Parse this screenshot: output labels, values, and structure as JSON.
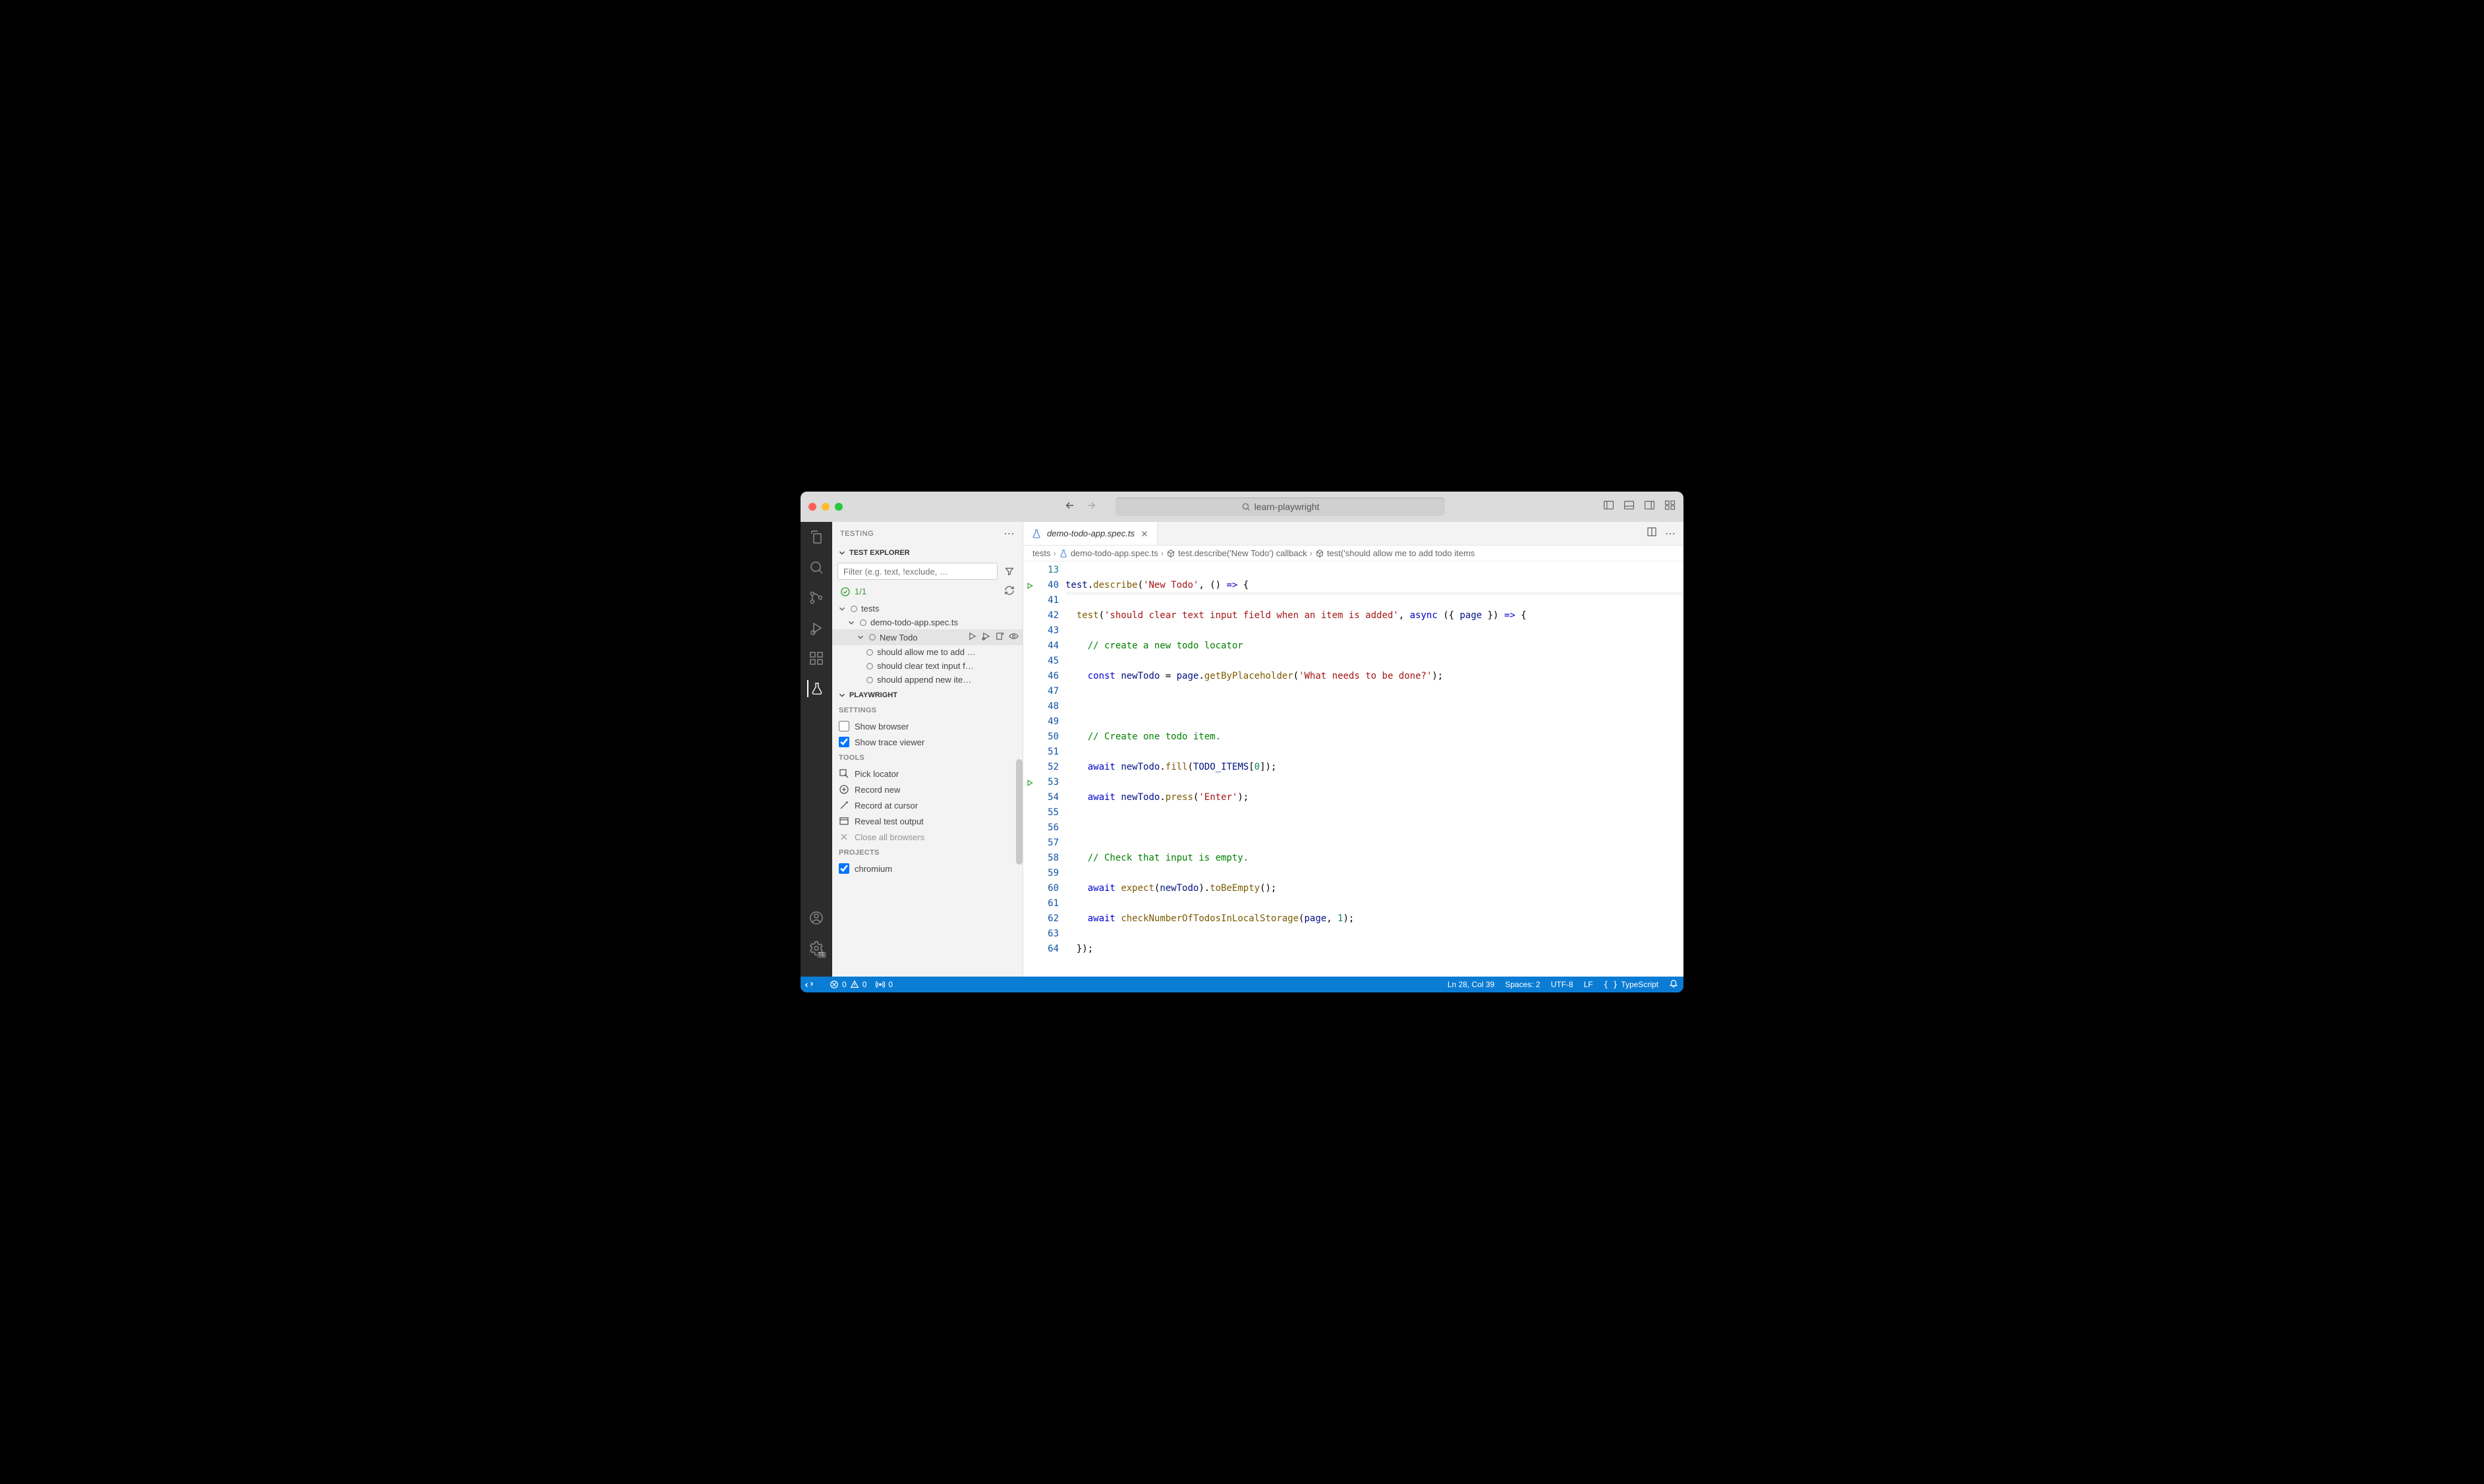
{
  "title": "learn-playwright",
  "sidebar": {
    "title": "TESTING",
    "explorer": "TEST EXPLORER",
    "filter_ph": "Filter (e.g. text, !exclude, …",
    "count": "1/1",
    "tree": {
      "root": "tests",
      "file": "demo-todo-app.spec.ts",
      "suite": "New Todo",
      "tests": [
        "should allow me to add …",
        "should clear text input f…",
        "should append new ite…"
      ]
    },
    "pw_title": "PLAYWRIGHT",
    "settings_title": "SETTINGS",
    "show_browser": "Show browser",
    "show_trace": "Show trace viewer",
    "tools_title": "TOOLS",
    "tools": [
      "Pick locator",
      "Record new",
      "Record at cursor",
      "Reveal test output",
      "Close all browsers"
    ],
    "projects_title": "PROJECTS",
    "project": "chromium"
  },
  "tab": {
    "name": "demo-todo-app.spec.ts"
  },
  "breadcrumb": {
    "p0": "tests",
    "p1": "demo-todo-app.spec.ts",
    "p2": "test.describe('New Todo') callback",
    "p3": "test('should allow me to add todo items"
  },
  "gutter": {
    "sticky": "13",
    "lines": [
      "40",
      "41",
      "42",
      "43",
      "44",
      "45",
      "46",
      "47",
      "48",
      "49",
      "50",
      "51",
      "52",
      "53",
      "54",
      "55",
      "56",
      "57",
      "58",
      "59",
      "60",
      "61",
      "62",
      "63",
      "64"
    ]
  },
  "status": {
    "errors": "0",
    "warnings": "0",
    "ports": "0",
    "pos": "Ln 28, Col 39",
    "spaces": "Spaces: 2",
    "enc": "UTF-8",
    "eol": "LF",
    "lang": "TypeScript"
  }
}
